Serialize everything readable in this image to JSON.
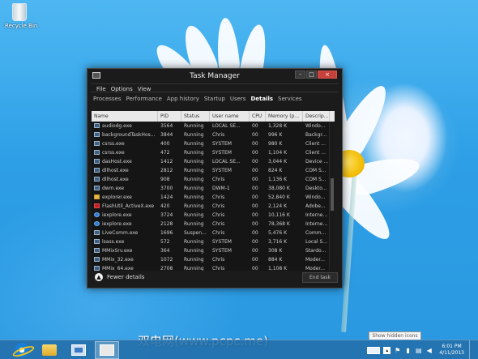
{
  "desktop": {
    "recycle_bin_label": "Recycle Bin"
  },
  "window": {
    "title": "Task Manager",
    "controls": {
      "minimize": "-",
      "maximize": "□",
      "close": "×"
    }
  },
  "menu": [
    "File",
    "Options",
    "View"
  ],
  "tabs": [
    {
      "label": "Processes",
      "active": false
    },
    {
      "label": "Performance",
      "active": false
    },
    {
      "label": "App history",
      "active": false
    },
    {
      "label": "Startup",
      "active": false
    },
    {
      "label": "Users",
      "active": false
    },
    {
      "label": "Details",
      "active": true
    },
    {
      "label": "Services",
      "active": false
    }
  ],
  "columns": [
    "Name",
    "PID",
    "Status",
    "User name",
    "CPU",
    "Memory (p...",
    "Descrip..."
  ],
  "rows": [
    {
      "icon": "app-icon",
      "name": "audiodg.exe",
      "pid": "3564",
      "status": "Running",
      "user": "LOCAL SE...",
      "cpu": "00",
      "mem": "1,328 K",
      "desc": "Windo..."
    },
    {
      "icon": "app-icon",
      "name": "backgroundTaskHos...",
      "pid": "3844",
      "status": "Running",
      "user": "Chris",
      "cpu": "00",
      "mem": "996 K",
      "desc": "Backgr..."
    },
    {
      "icon": "app-icon",
      "name": "csrss.exe",
      "pid": "400",
      "status": "Running",
      "user": "SYSTEM",
      "cpu": "00",
      "mem": "980 K",
      "desc": "Client ..."
    },
    {
      "icon": "app-icon",
      "name": "csrss.exe",
      "pid": "472",
      "status": "Running",
      "user": "SYSTEM",
      "cpu": "00",
      "mem": "1,104 K",
      "desc": "Client ..."
    },
    {
      "icon": "app-icon",
      "name": "dasHost.exe",
      "pid": "1412",
      "status": "Running",
      "user": "LOCAL SE...",
      "cpu": "00",
      "mem": "3,044 K",
      "desc": "Device ..."
    },
    {
      "icon": "app-icon",
      "name": "dllhost.exe",
      "pid": "2812",
      "status": "Running",
      "user": "SYSTEM",
      "cpu": "00",
      "mem": "824 K",
      "desc": "COM S..."
    },
    {
      "icon": "app-icon",
      "name": "dllhost.exe",
      "pid": "908",
      "status": "Running",
      "user": "Chris",
      "cpu": "00",
      "mem": "1,136 K",
      "desc": "COM S..."
    },
    {
      "icon": "app-icon",
      "name": "dwm.exe",
      "pid": "3700",
      "status": "Running",
      "user": "DWM-1",
      "cpu": "00",
      "mem": "38,080 K",
      "desc": "Deskto..."
    },
    {
      "icon": "explorer-icon",
      "name": "explorer.exe",
      "pid": "1424",
      "status": "Running",
      "user": "Chris",
      "cpu": "00",
      "mem": "52,840 K",
      "desc": "Windo..."
    },
    {
      "icon": "flash-icon",
      "name": "FlashUtil_ActiveX.exe",
      "pid": "420",
      "status": "Running",
      "user": "Chris",
      "cpu": "00",
      "mem": "2,124 K",
      "desc": "Adobe..."
    },
    {
      "icon": "ie-icon",
      "name": "iexplore.exe",
      "pid": "3724",
      "status": "Running",
      "user": "Chris",
      "cpu": "00",
      "mem": "10,116 K",
      "desc": "Interne..."
    },
    {
      "icon": "ie-icon",
      "name": "iexplore.exe",
      "pid": "2128",
      "status": "Running",
      "user": "Chris",
      "cpu": "00",
      "mem": "78,368 K",
      "desc": "Interne..."
    },
    {
      "icon": "app-icon",
      "name": "LiveComm.exe",
      "pid": "1696",
      "status": "Suspen...",
      "user": "Chris",
      "cpu": "00",
      "mem": "5,476 K",
      "desc": "Comm..."
    },
    {
      "icon": "app-icon",
      "name": "lsass.exe",
      "pid": "572",
      "status": "Running",
      "user": "SYSTEM",
      "cpu": "00",
      "mem": "3,716 K",
      "desc": "Local S..."
    },
    {
      "icon": "app-icon",
      "name": "MMixSrv.exe",
      "pid": "364",
      "status": "Running",
      "user": "SYSTEM",
      "cpu": "00",
      "mem": "308 K",
      "desc": "Stardo..."
    },
    {
      "icon": "app-icon",
      "name": "MMix_32.exe",
      "pid": "1072",
      "status": "Running",
      "user": "Chris",
      "cpu": "00",
      "mem": "884 K",
      "desc": "Moder..."
    },
    {
      "icon": "app-icon",
      "name": "MMix_64.exe",
      "pid": "2708",
      "status": "Running",
      "user": "Chris",
      "cpu": "00",
      "mem": "1,108 K",
      "desc": "Moder..."
    }
  ],
  "footer": {
    "fewer_details": "Fewer details",
    "end_task": "End task"
  },
  "watermark": "双电网(www.pcpc.me)",
  "taskbar": {
    "tooltip": "Show hidden icons",
    "time": "6:01 PM",
    "date": "4/11/2013",
    "tray_chevron": "▴"
  }
}
